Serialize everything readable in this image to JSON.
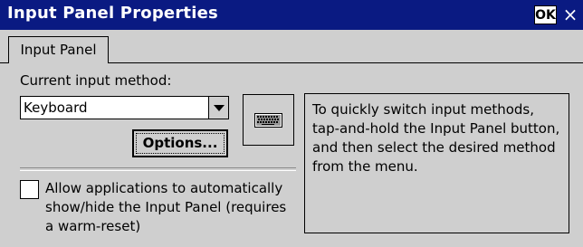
{
  "window": {
    "title": "Input Panel Properties",
    "ok_label": "OK",
    "close_label": "×"
  },
  "tabs": [
    {
      "label": "Input Panel",
      "selected": true
    }
  ],
  "panel": {
    "current_method_label": "Current input method:",
    "method_select": {
      "value": "Keyboard"
    },
    "options_button": "Options...",
    "keyboard_icon": "keyboard-icon",
    "checkbox": {
      "checked": false,
      "label": "Allow applications to automatically show/hide the Input Panel (requires a warm-reset)"
    },
    "info_text": "To quickly switch input methods, tap-and-hold the Input Panel button, and then select the desired method from the menu."
  },
  "colors": {
    "titlebar": "#0a1a82",
    "face": "#cfcfcf"
  }
}
